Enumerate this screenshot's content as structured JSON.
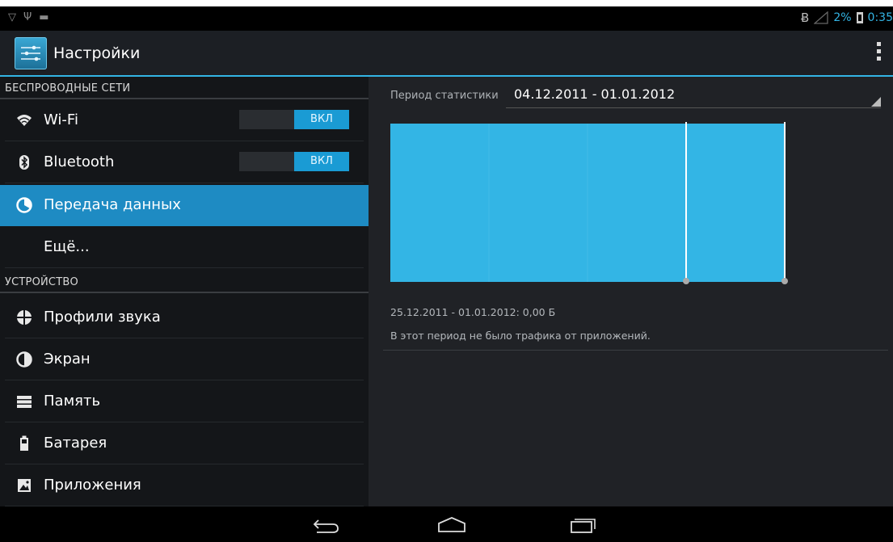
{
  "status_bar": {
    "left_icons": [
      "wifi-icon",
      "usb-icon",
      "android-icon"
    ],
    "battery_percent": "2%",
    "time": "0:35"
  },
  "action_bar": {
    "title": "Настройки",
    "icon": "settings-sliders-icon",
    "overflow_icon": "overflow-menu-icon"
  },
  "sidebar": {
    "sections": [
      {
        "header": "БЕСПРОВОДНЫЕ СЕТИ"
      },
      {
        "header": "УСТРОЙСТВО"
      }
    ],
    "items": [
      {
        "label": "Wi-Fi",
        "icon": "wifi-icon",
        "toggle": "ВКЛ"
      },
      {
        "label": "Bluetooth",
        "icon": "bluetooth-icon",
        "toggle": "ВКЛ"
      },
      {
        "label": "Передача данных",
        "icon": "data-usage-icon",
        "selected": true
      },
      {
        "label": "Ещё...",
        "icon": ""
      },
      {
        "label": "Профили звука",
        "icon": "sound-icon"
      },
      {
        "label": "Экран",
        "icon": "display-icon"
      },
      {
        "label": "Память",
        "icon": "storage-icon"
      },
      {
        "label": "Батарея",
        "icon": "battery-icon"
      },
      {
        "label": "Приложения",
        "icon": "apps-icon"
      }
    ]
  },
  "data_usage": {
    "period_label": "Период статистики",
    "period_value": "04.12.2011 - 01.01.2012",
    "summary": "25.12.2011 - 01.01.2012: 0,00 Б",
    "no_traffic": "В этот период не было трафика от приложений."
  },
  "chart_data": {
    "type": "area",
    "title": "",
    "x_range": [
      "04.12.2011",
      "01.01.2012"
    ],
    "selected_range": [
      "25.12.2011",
      "01.01.2012"
    ],
    "usage_bytes": 0,
    "fill_color": "#33b5e5",
    "gridlines": 4
  },
  "nav_bar": {
    "buttons": [
      "back-icon",
      "home-icon",
      "recent-apps-icon"
    ]
  },
  "colors": {
    "accent": "#33b5e5",
    "selected_item": "#1e8bc3",
    "toggle_on": "#1a9bd4",
    "background_dark": "#141619"
  }
}
